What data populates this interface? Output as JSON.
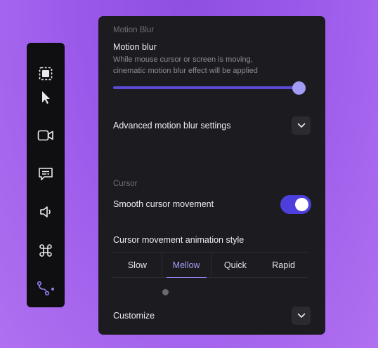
{
  "toolbar": {
    "tools": [
      {
        "icon": "select-region-icon"
      },
      {
        "icon": "cursor-arrow-icon"
      },
      {
        "icon": "video-camera-icon"
      },
      {
        "icon": "captions-icon"
      },
      {
        "icon": "speaker-icon"
      },
      {
        "icon": "command-key-icon"
      },
      {
        "icon": "cursor-path-icon"
      }
    ],
    "active_color": "#8c80f0"
  },
  "motion_blur": {
    "section_title": "Motion Blur",
    "label": "Motion blur",
    "description": "While mouse cursor or screen is moving, cinematic motion blur effect will be applied",
    "slider_value": 1.0,
    "advanced_label": "Advanced motion blur settings"
  },
  "cursor": {
    "section_title": "Cursor",
    "smooth_label": "Smooth cursor movement",
    "smooth_enabled": true,
    "animation_style_label": "Cursor movement animation style",
    "animation_styles": [
      "Slow",
      "Mellow",
      "Quick",
      "Rapid"
    ],
    "selected_style": "Mellow",
    "customize_label": "Customize"
  },
  "colors": {
    "accent": "#4d3fdc",
    "slider_thumb": "#a39bf5",
    "panel_bg": "#1c1c20"
  }
}
